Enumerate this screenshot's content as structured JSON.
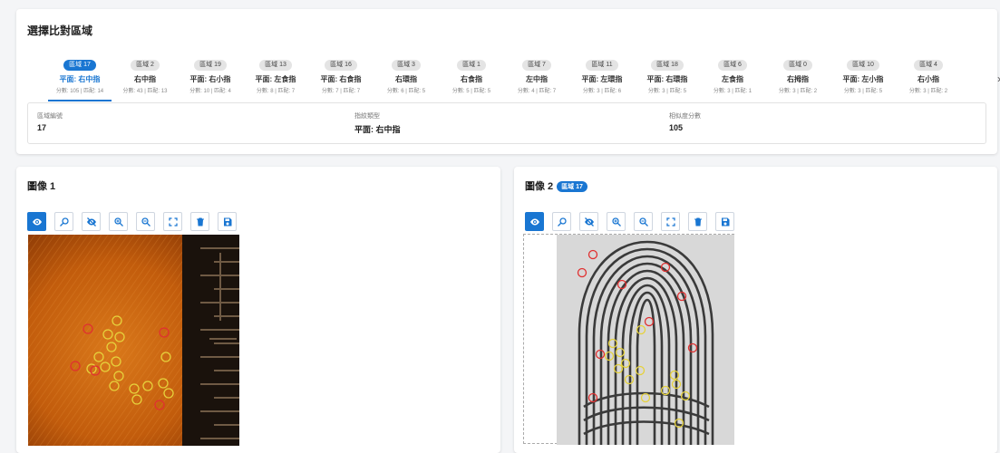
{
  "selection": {
    "title": "選擇比對區域",
    "tabs": [
      {
        "region": "區域 17",
        "finger": "平面: 右中指",
        "score": "分數: 105 | 匹配: 14"
      },
      {
        "region": "區域 2",
        "finger": "右中指",
        "score": "分數: 43 | 匹配: 13"
      },
      {
        "region": "區域 19",
        "finger": "平面: 右小指",
        "score": "分數: 10 | 匹配: 4"
      },
      {
        "region": "區域 13",
        "finger": "平面: 左食指",
        "score": "分數: 8 | 匹配: 7"
      },
      {
        "region": "區域 16",
        "finger": "平面: 右食指",
        "score": "分數: 7 | 匹配: 7"
      },
      {
        "region": "區域 3",
        "finger": "右環指",
        "score": "分數: 6 | 匹配: 5"
      },
      {
        "region": "區域 1",
        "finger": "右食指",
        "score": "分數: 5 | 匹配: 5"
      },
      {
        "region": "區域 7",
        "finger": "左中指",
        "score": "分數: 4 | 匹配: 7"
      },
      {
        "region": "區域 11",
        "finger": "平面: 左環指",
        "score": "分數: 3 | 匹配: 6"
      },
      {
        "region": "區域 18",
        "finger": "平面: 右環指",
        "score": "分數: 3 | 匹配: 5"
      },
      {
        "region": "區域 6",
        "finger": "左食指",
        "score": "分數: 3 | 匹配: 1"
      },
      {
        "region": "區域 0",
        "finger": "右拇指",
        "score": "分數: 3 | 匹配: 2"
      },
      {
        "region": "區域 10",
        "finger": "平面: 左小指",
        "score": "分數: 3 | 匹配: 5"
      },
      {
        "region": "區域 4",
        "finger": "右小指",
        "score": "分數: 3 | 匹配: 2"
      }
    ],
    "next_icon": "›",
    "info": {
      "region_label": "區域編號",
      "region_value": "17",
      "type_label": "指紋類型",
      "type_value": "平面: 右中指",
      "score_label": "相似度分數",
      "score_value": "105"
    }
  },
  "image1": {
    "title": "圖像 1"
  },
  "image2": {
    "title": "圖像 2",
    "badge": "區域 17"
  },
  "toolbar_icons": [
    "eye-icon",
    "zoom-tool-icon",
    "eye-off-icon",
    "zoom-in-icon",
    "zoom-out-icon",
    "fit-screen-icon",
    "delete-icon",
    "save-icon"
  ],
  "colors": {
    "accent": "#1976d2",
    "minutia_match": "#e6d23c",
    "minutia_other": "#e03030",
    "latent_bg": "#c8620e"
  }
}
